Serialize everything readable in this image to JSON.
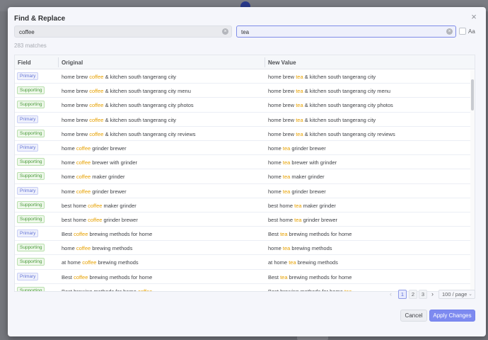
{
  "dialog": {
    "title": "Find & Replace",
    "find_value": "coffee",
    "replace_value": "tea",
    "case_label": "Aa",
    "match_count": "283 matches"
  },
  "table": {
    "headers": {
      "field": "Field",
      "original": "Original",
      "new_value": "New Value"
    },
    "find_term": "coffee",
    "replace_term": "tea",
    "rows": [
      {
        "field": "Primary",
        "before": "home brew ",
        "after": " & kitchen south tangerang city"
      },
      {
        "field": "Supporting",
        "before": "home brew ",
        "after": " & kitchen south tangerang city menu"
      },
      {
        "field": "Supporting",
        "before": "home brew ",
        "after": " & kitchen south tangerang city photos"
      },
      {
        "field": "Primary",
        "before": "home brew ",
        "after": " & kitchen south tangerang city"
      },
      {
        "field": "Supporting",
        "before": "home brew ",
        "after": " & kitchen south tangerang city reviews"
      },
      {
        "field": "Primary",
        "before": "home ",
        "after": " grinder brewer"
      },
      {
        "field": "Supporting",
        "before": "home ",
        "after": " brewer with grinder"
      },
      {
        "field": "Supporting",
        "before": "home ",
        "after": " maker grinder"
      },
      {
        "field": "Primary",
        "before": "home ",
        "after": " grinder brewer"
      },
      {
        "field": "Supporting",
        "before": "best home ",
        "after": " maker grinder"
      },
      {
        "field": "Supporting",
        "before": "best home ",
        "after": " grinder brewer"
      },
      {
        "field": "Primary",
        "before": "Best ",
        "after": " brewing methods for home"
      },
      {
        "field": "Supporting",
        "before": "home ",
        "after": " brewing methods"
      },
      {
        "field": "Supporting",
        "before": "at home ",
        "after": " brewing methods"
      },
      {
        "field": "Primary",
        "before": "Best ",
        "after": " brewing methods for home"
      },
      {
        "field": "Supporting",
        "before": "Best brewing methods for home ",
        "after": ""
      }
    ]
  },
  "pagination": {
    "pages": [
      "1",
      "2",
      "3"
    ],
    "active_page": "1",
    "page_size": "100 / page"
  },
  "buttons": {
    "cancel": "Cancel",
    "apply": "Apply Changes"
  },
  "colors": {
    "accent": "#7d8af0",
    "highlight": "#e6a000",
    "primary_badge": "#6575d6",
    "supporting_badge": "#4a9a3a"
  }
}
